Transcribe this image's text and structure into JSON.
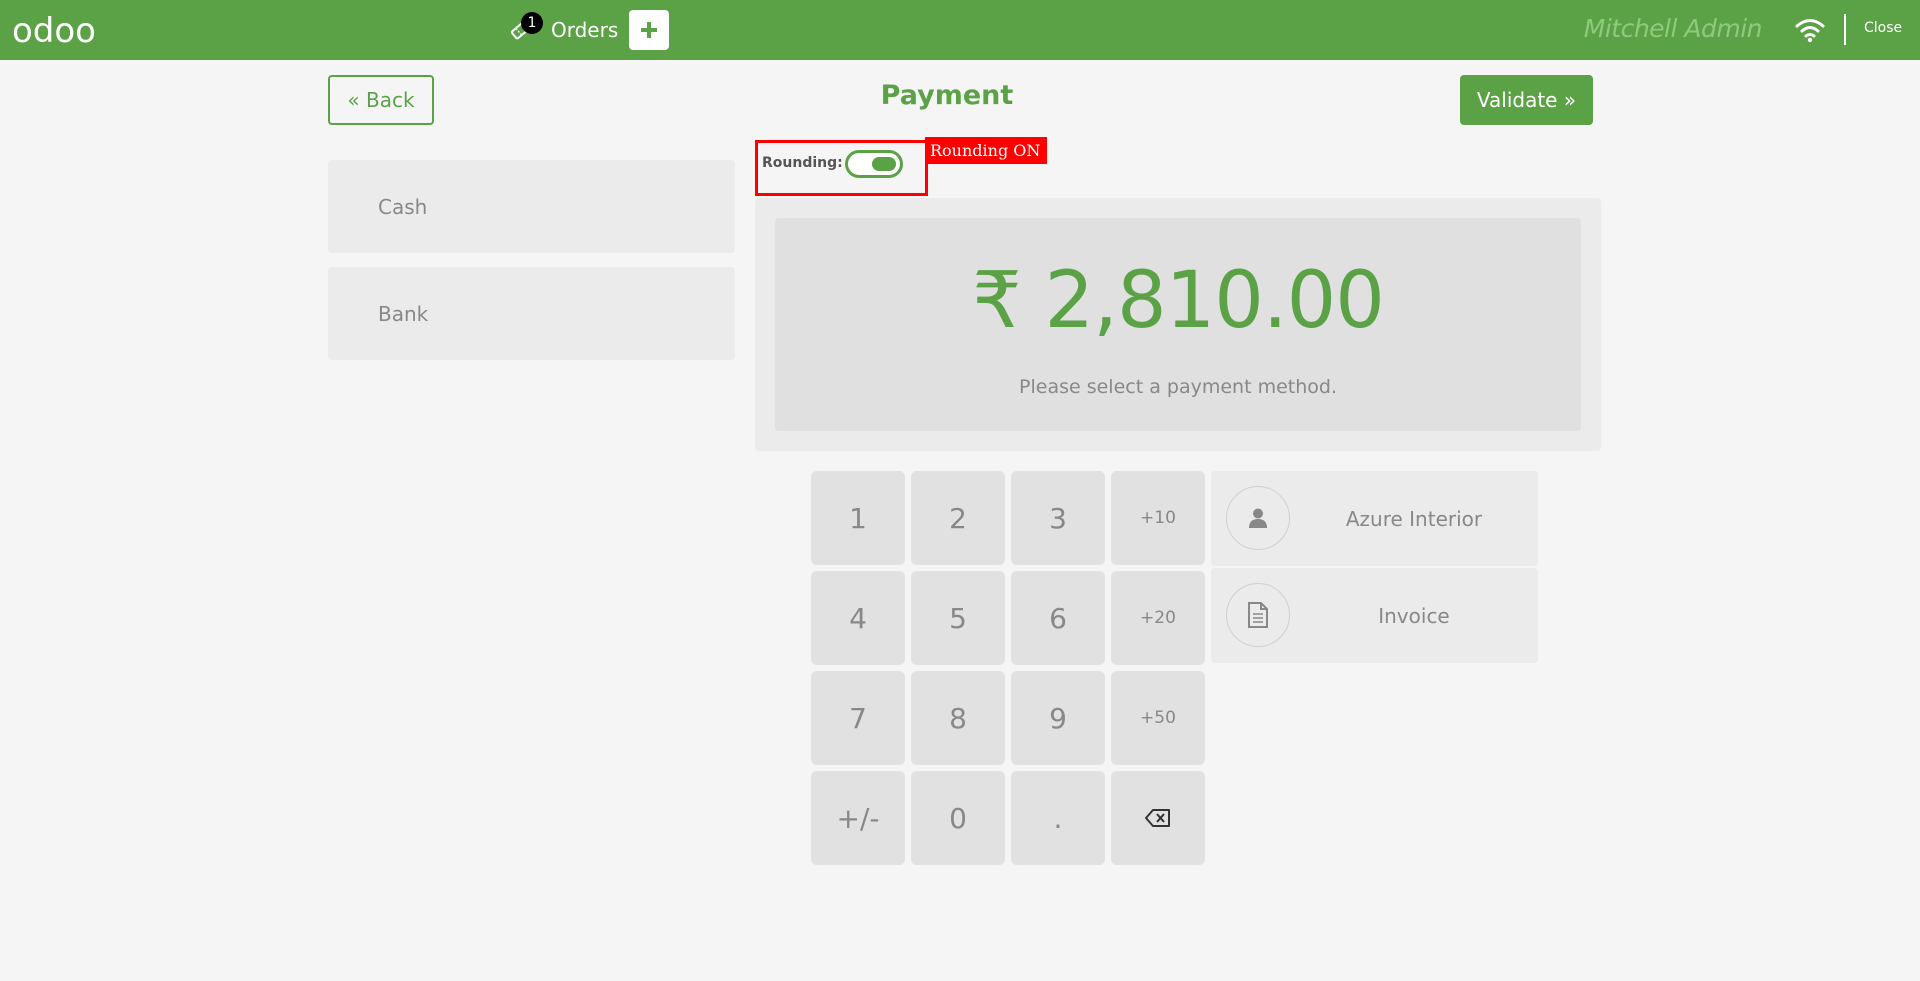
{
  "header": {
    "logo_text": "odoo",
    "orders_count": "1",
    "orders_label": "Orders",
    "new_order_symbol": "+",
    "cashier": "Mitchell Admin",
    "close_label": "Close"
  },
  "payment": {
    "back_label": "« Back",
    "title": "Payment",
    "validate_label": "Validate »",
    "methods": [
      "Cash",
      "Bank"
    ],
    "rounding_label": "Rounding:",
    "rounding_on": true,
    "rounding_tag": "Rounding ON",
    "amount": "₹ 2,810.00",
    "hint": "Please select a payment method."
  },
  "numpad": {
    "keys": [
      "1",
      "2",
      "3",
      "+10",
      "4",
      "5",
      "6",
      "+20",
      "7",
      "8",
      "9",
      "+50",
      "+/-",
      "0",
      ".",
      "backspace"
    ]
  },
  "actions": {
    "customer": "Azure Interior",
    "invoice": "Invoice"
  },
  "colors": {
    "brand": "#5ba246",
    "highlight": "#ff0000"
  },
  "icons": [
    "ticket-icon",
    "plus-icon",
    "wifi-icon",
    "user-icon",
    "document-icon",
    "backspace-icon"
  ]
}
